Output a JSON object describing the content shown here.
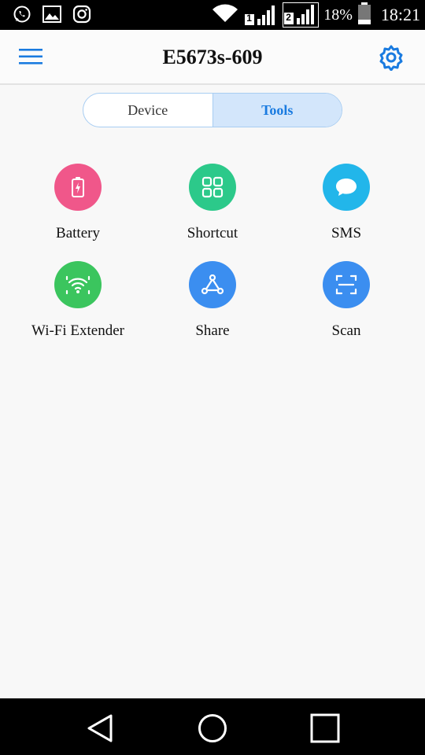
{
  "status_bar": {
    "battery_percent": "18%",
    "time": "18:21",
    "sim1": "1",
    "sim2": "2",
    "icons": [
      "whatsapp-icon",
      "gallery-icon",
      "instagram-icon",
      "wifi-icon",
      "signal-sim1-icon",
      "signal-sim2-icon",
      "battery-icon"
    ]
  },
  "header": {
    "title": "E5673s-609",
    "menu_icon": "hamburger-menu-icon",
    "settings_icon": "gear-icon"
  },
  "tabs": [
    {
      "label": "Device",
      "active": false
    },
    {
      "label": "Tools",
      "active": true
    }
  ],
  "tools": [
    {
      "label": "Battery",
      "icon": "battery-icon",
      "color": "#f0578a"
    },
    {
      "label": "Shortcut",
      "icon": "grid-icon",
      "color": "#2cc98a"
    },
    {
      "label": "SMS",
      "icon": "chat-bubble-icon",
      "color": "#22b6ea"
    },
    {
      "label": "Wi-Fi Extender",
      "icon": "wifi-extender-icon",
      "color": "#3bc55e"
    },
    {
      "label": "Share",
      "icon": "share-icon",
      "color": "#3b8ef0"
    },
    {
      "label": "Scan",
      "icon": "scan-icon",
      "color": "#3b8ef0"
    }
  ],
  "colors": {
    "accent": "#1a7be0",
    "tab_active_bg": "#d3e6fb"
  },
  "nav_bar": {
    "icons": [
      "back-icon",
      "home-icon",
      "recents-icon"
    ]
  }
}
